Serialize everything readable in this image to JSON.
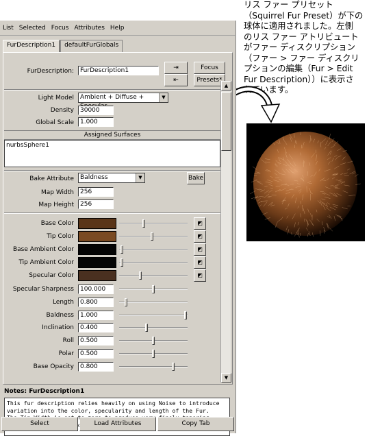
{
  "caption": "リス ファー プリセット\n（Squirrel Fur Preset）が下の\n球体に適用されました。左側\nのリス ファー アトリビュート\nがファー ディスクリプション\n（ファー > ファー ディスクリ\nプションの編集（Fur > Edit\nFur Description））に表示さ\nれています。",
  "menu": [
    "List",
    "Selected",
    "Focus",
    "Attributes",
    "Help"
  ],
  "tabs": [
    "FurDescription1",
    "defaultFurGlobals"
  ],
  "fur_description": {
    "label": "FurDescription:",
    "value": "FurDescription1",
    "focus": "Focus",
    "presets": "Presets*"
  },
  "light_model": {
    "label": "Light Model",
    "value": "Ambient + Diffuse + Specular"
  },
  "density": {
    "label": "Density",
    "value": "30000"
  },
  "global_scale": {
    "label": "Global Scale",
    "value": "1.000"
  },
  "assigned_surfaces": {
    "header": "Assigned Surfaces",
    "items": [
      "nurbsSphere1"
    ]
  },
  "bake": {
    "label": "Bake Attribute",
    "value": "Baldness",
    "button": "Bake"
  },
  "map_width": {
    "label": "Map Width",
    "value": "256"
  },
  "map_height": {
    "label": "Map Height",
    "value": "256"
  },
  "colors": [
    {
      "label": "Base Color",
      "color": "#5a3518",
      "slider": 0.35
    },
    {
      "label": "Tip Color",
      "color": "#7a4a22",
      "slider": 0.48
    },
    {
      "label": "Base Ambient Color",
      "color": "#050505",
      "slider": 0.02
    },
    {
      "label": "Tip Ambient Color",
      "color": "#050505",
      "slider": 0.02
    },
    {
      "label": "Specular Color",
      "color": "#4a3020",
      "slider": 0.3
    }
  ],
  "numeric": [
    {
      "label": "Specular Sharpness",
      "value": "100.000",
      "slider": 0.5
    },
    {
      "label": "Length",
      "value": "0.800",
      "slider": 0.08
    },
    {
      "label": "Baldness",
      "value": "1.000",
      "slider": 0.99
    },
    {
      "label": "Inclination",
      "value": "0.400",
      "slider": 0.4
    },
    {
      "label": "Roll",
      "value": "0.500",
      "slider": 0.5
    },
    {
      "label": "Polar",
      "value": "0.500",
      "slider": 0.5
    },
    {
      "label": "Base Opacity",
      "value": "0.800",
      "slider": 0.8
    }
  ],
  "notes": {
    "title": "Notes: FurDescription1",
    "text": "This fur description relies heavily on using Noise to introduce variation into the color, specularity and length of the Fur. The Tip Width is set to zero to produce very finely tapering hairs for a soft effect."
  },
  "bottom_buttons": [
    "Select",
    "Load Attributes",
    "Copy Tab"
  ]
}
